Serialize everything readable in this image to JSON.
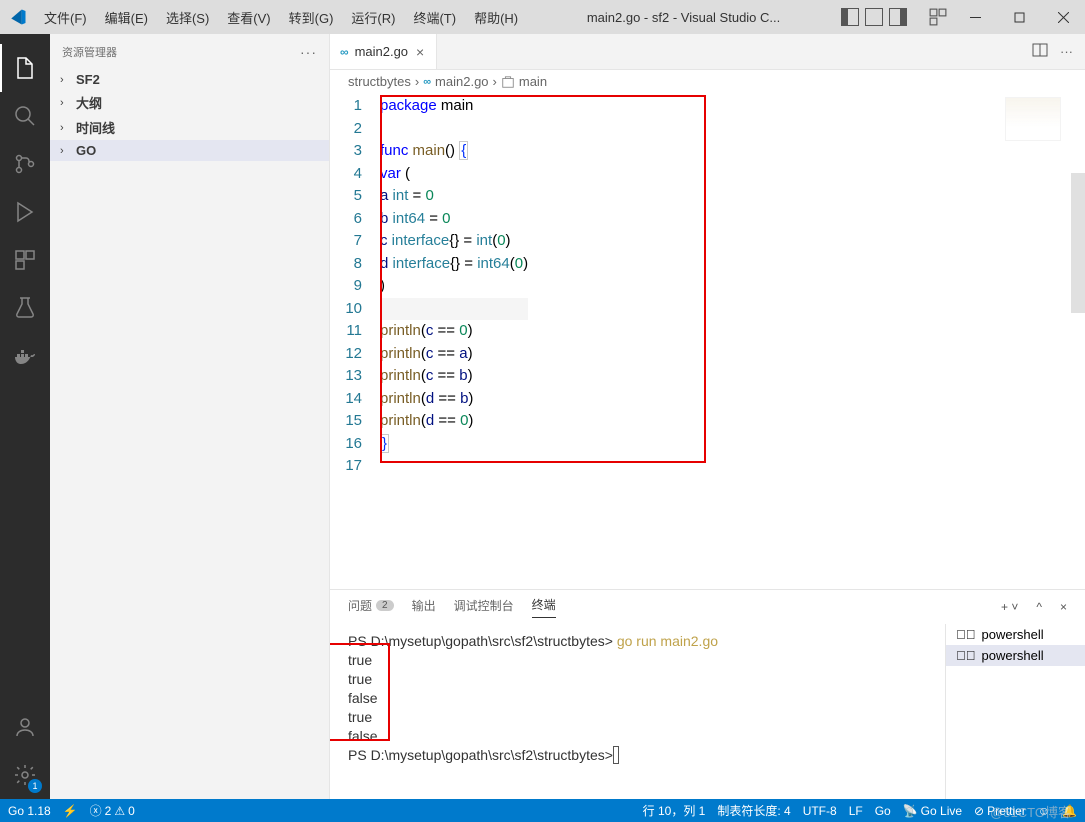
{
  "titlebar": {
    "menus": [
      "文件(F)",
      "编辑(E)",
      "选择(S)",
      "查看(V)",
      "转到(G)",
      "运行(R)",
      "终端(T)",
      "帮助(H)"
    ],
    "title": "main2.go - sf2 - Visual Studio C..."
  },
  "sidebar": {
    "header": "资源管理器",
    "sections": [
      "SF2",
      "大纲",
      "时间线",
      "GO"
    ]
  },
  "tab": {
    "filename": "main2.go"
  },
  "breadcrumbs": {
    "root": "structbytes",
    "file": "main2.go",
    "symbol": "main"
  },
  "code": {
    "lines": [
      {
        "n": 1,
        "seg": [
          [
            "kw",
            "package"
          ],
          [
            "sp",
            " "
          ],
          [
            "op",
            "main"
          ]
        ]
      },
      {
        "n": 2,
        "seg": []
      },
      {
        "n": 3,
        "seg": [
          [
            "kw",
            "func"
          ],
          [
            "sp",
            " "
          ],
          [
            "fn",
            "main"
          ],
          [
            "op",
            "()"
          ],
          [
            "sp",
            " "
          ],
          [
            "brx",
            "{"
          ]
        ]
      },
      {
        "n": 4,
        "seg": [
          [
            "ind",
            "    "
          ],
          [
            "kw",
            "var"
          ],
          [
            "sp",
            " "
          ],
          [
            "op",
            "("
          ]
        ]
      },
      {
        "n": 5,
        "seg": [
          [
            "ind",
            "        "
          ],
          [
            "var",
            "a"
          ],
          [
            "sp",
            " "
          ],
          [
            "ty",
            "int"
          ],
          [
            "pad",
            "         "
          ],
          [
            "op",
            "= "
          ],
          [
            "nm",
            "0"
          ]
        ]
      },
      {
        "n": 6,
        "seg": [
          [
            "ind",
            "        "
          ],
          [
            "var",
            "b"
          ],
          [
            "sp",
            " "
          ],
          [
            "ty",
            "int64"
          ],
          [
            "pad",
            "       "
          ],
          [
            "op",
            "= "
          ],
          [
            "nm",
            "0"
          ]
        ]
      },
      {
        "n": 7,
        "seg": [
          [
            "ind",
            "        "
          ],
          [
            "var",
            "c"
          ],
          [
            "sp",
            " "
          ],
          [
            "ty",
            "interface"
          ],
          [
            "op",
            "{} = "
          ],
          [
            "ty",
            "int"
          ],
          [
            "op",
            "("
          ],
          [
            "nm",
            "0"
          ],
          [
            "op",
            ")"
          ]
        ]
      },
      {
        "n": 8,
        "seg": [
          [
            "ind",
            "        "
          ],
          [
            "var",
            "d"
          ],
          [
            "sp",
            " "
          ],
          [
            "ty",
            "interface"
          ],
          [
            "op",
            "{} = "
          ],
          [
            "ty",
            "int64"
          ],
          [
            "op",
            "("
          ],
          [
            "nm",
            "0"
          ],
          [
            "op",
            ")"
          ]
        ]
      },
      {
        "n": 9,
        "seg": [
          [
            "ind",
            "    "
          ],
          [
            "op",
            ")"
          ]
        ]
      },
      {
        "n": 10,
        "seg": [],
        "hl": true
      },
      {
        "n": 11,
        "seg": [
          [
            "ind",
            "    "
          ],
          [
            "fn",
            "println"
          ],
          [
            "op",
            "("
          ],
          [
            "var",
            "c"
          ],
          [
            "op",
            " == "
          ],
          [
            "nm",
            "0"
          ],
          [
            "op",
            ")"
          ]
        ]
      },
      {
        "n": 12,
        "seg": [
          [
            "ind",
            "    "
          ],
          [
            "fn",
            "println"
          ],
          [
            "op",
            "("
          ],
          [
            "var",
            "c"
          ],
          [
            "op",
            " == "
          ],
          [
            "var",
            "a"
          ],
          [
            "op",
            ")"
          ]
        ]
      },
      {
        "n": 13,
        "seg": [
          [
            "ind",
            "    "
          ],
          [
            "fn",
            "println"
          ],
          [
            "op",
            "("
          ],
          [
            "var",
            "c"
          ],
          [
            "op",
            " == "
          ],
          [
            "var",
            "b"
          ],
          [
            "op",
            ")"
          ]
        ]
      },
      {
        "n": 14,
        "seg": [
          [
            "ind",
            "    "
          ],
          [
            "fn",
            "println"
          ],
          [
            "op",
            "("
          ],
          [
            "var",
            "d"
          ],
          [
            "op",
            " == "
          ],
          [
            "var",
            "b"
          ],
          [
            "op",
            ")"
          ]
        ]
      },
      {
        "n": 15,
        "seg": [
          [
            "ind",
            "    "
          ],
          [
            "fn",
            "println"
          ],
          [
            "op",
            "("
          ],
          [
            "var",
            "d"
          ],
          [
            "op",
            " == "
          ],
          [
            "nm",
            "0"
          ],
          [
            "op",
            ")"
          ]
        ]
      },
      {
        "n": 16,
        "seg": [
          [
            "brx",
            "}"
          ]
        ]
      },
      {
        "n": 17,
        "seg": []
      }
    ]
  },
  "panel": {
    "tabs": {
      "problems": "问题",
      "problems_count": "2",
      "output": "输出",
      "debug": "调试控制台",
      "terminal": "终端"
    },
    "term": {
      "prompt1": "PS D:\\mysetup\\gopath\\src\\sf2\\structbytes>",
      "cmd": "go run main2.go",
      "out": [
        "true",
        "true",
        "false",
        "true",
        "false"
      ],
      "prompt2": "PS D:\\mysetup\\gopath\\src\\sf2\\structbytes>"
    },
    "shells": [
      "powershell",
      "powershell"
    ]
  },
  "status": {
    "go": "Go 1.18",
    "err": "2",
    "warn": "0",
    "pos": "行 10，列 1",
    "tab": "制表符长度: 4",
    "enc": "UTF-8",
    "eol": "LF",
    "lang": "Go",
    "live": "Go Live",
    "prettier": "Prettier"
  }
}
